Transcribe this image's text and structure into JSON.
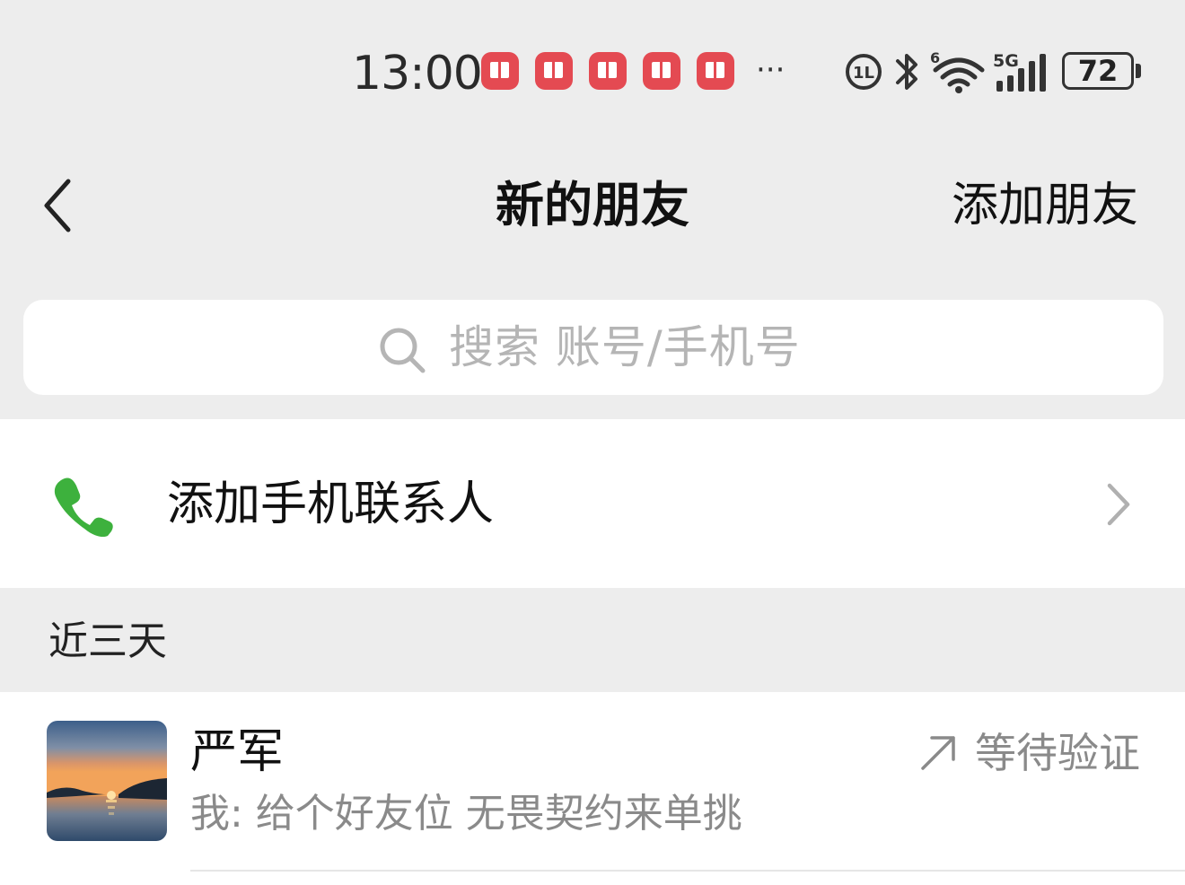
{
  "status_bar": {
    "time": "13:00",
    "notification_icons": [
      "book-app-icon",
      "book-app-icon",
      "book-app-icon",
      "book-app-icon",
      "book-app-icon"
    ],
    "more_indicator": "···",
    "network_labels": {
      "wifi_generation": "6",
      "cellular": "5G"
    },
    "battery_level": "72"
  },
  "nav": {
    "back_icon": "chevron-left-icon",
    "title": "新的朋友",
    "action_label": "添加朋友"
  },
  "search": {
    "placeholder": "搜索 账号/手机号",
    "icon": "search-icon"
  },
  "phone_contacts": {
    "label": "添加手机联系人",
    "icon": "phone-icon",
    "icon_color": "#3db13d"
  },
  "section": {
    "title": "近三天"
  },
  "requests": [
    {
      "name": "严军",
      "message": "我: 给个好友位 无畏契约来单挑",
      "status": "等待验证",
      "status_icon": "sent-arrow-icon",
      "avatar": "sunset-lake-photo"
    }
  ],
  "colors": {
    "page_background": "#ededed",
    "card_background": "#ffffff",
    "notification_red": "#e44a52",
    "secondary_text": "#8a8a8a",
    "placeholder_text": "#b5b5b5"
  }
}
